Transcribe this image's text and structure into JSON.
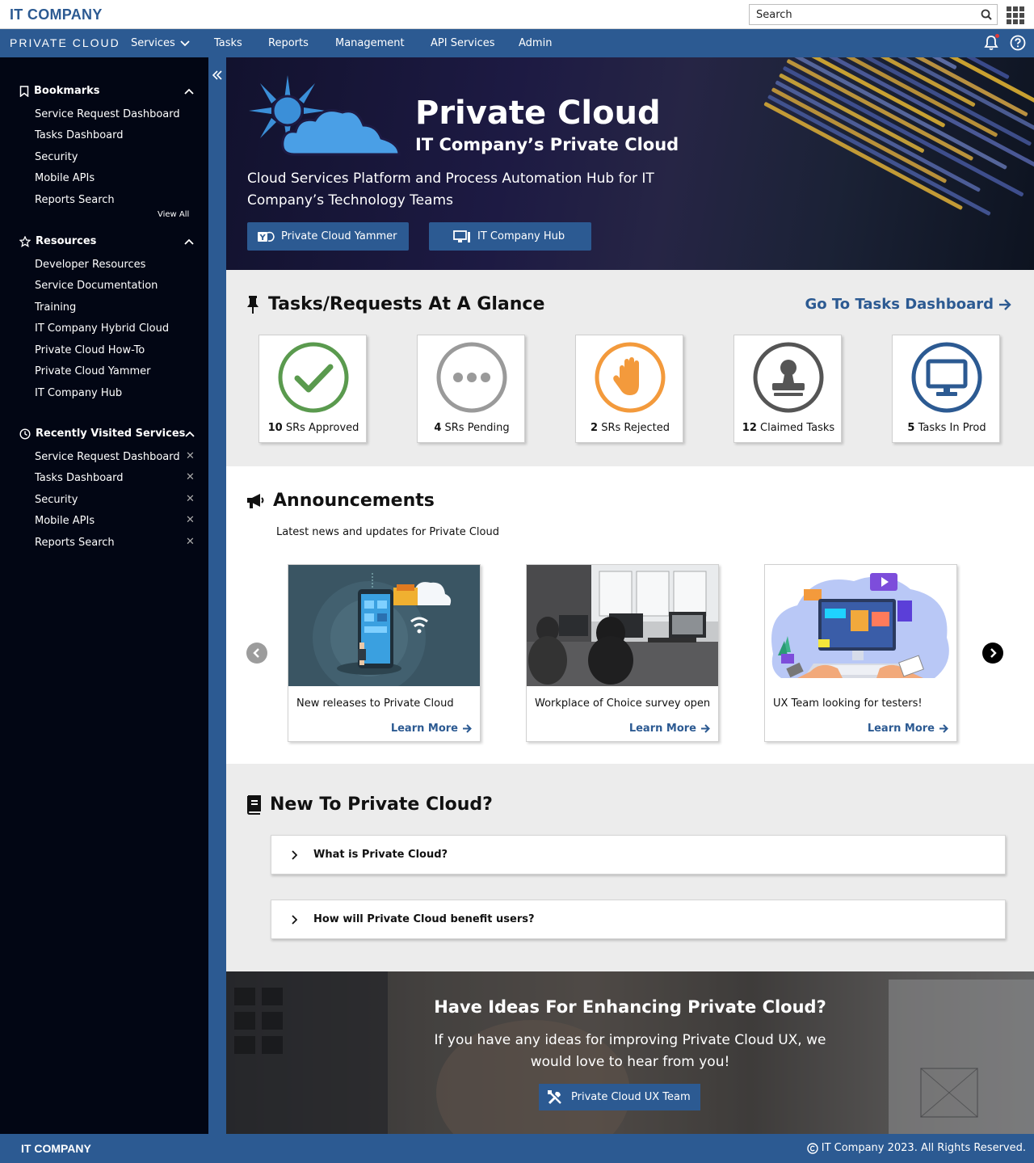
{
  "topbar": {
    "logo": "IT COMPANY",
    "search_placeholder": "Search"
  },
  "navbar": {
    "brand": "PRIVATE CLOUD",
    "items": [
      {
        "label": "Services"
      },
      {
        "label": "Tasks"
      },
      {
        "label": "Reports"
      },
      {
        "label": "Management"
      },
      {
        "label": "API Services"
      },
      {
        "label": "Admin"
      }
    ]
  },
  "sidebar": {
    "bookmarks": {
      "title": "Bookmarks",
      "items": [
        "Service Request Dashboard",
        "Tasks Dashboard",
        "Security",
        "Mobile APIs",
        "Reports Search"
      ],
      "view_all": "View All"
    },
    "resources": {
      "title": "Resources",
      "items": [
        "Developer Resources",
        "Service Documentation",
        "Training",
        "IT Company Hybrid Cloud",
        "Private Cloud How-To",
        "Private Cloud Yammer",
        "IT Company Hub"
      ]
    },
    "recent": {
      "title": "Recently Visited Services",
      "items": [
        "Service Request Dashboard",
        "Tasks Dashboard",
        "Security",
        "Mobile APIs",
        "Reports Search"
      ]
    }
  },
  "hero": {
    "title": "Private Cloud",
    "subtitle": "IT Company’s Private Cloud",
    "description": "Cloud Services Platform and Process Automation Hub for IT Company’s Technology Teams",
    "buttons": [
      "Private Cloud Yammer",
      "IT Company Hub"
    ]
  },
  "tasks": {
    "title": "Tasks/Requests At A Glance",
    "link": "Go To Tasks Dashboard",
    "cards": [
      {
        "count": "10",
        "label": "SRs Approved",
        "color": "#5a9a4e"
      },
      {
        "count": "4",
        "label": "SRs Pending",
        "color": "#9a9a9a"
      },
      {
        "count": "2",
        "label": "SRs Rejected",
        "color": "#f39a3c"
      },
      {
        "count": "12",
        "label": "Claimed Tasks",
        "color": "#555555"
      },
      {
        "count": "5",
        "label": "Tasks In Prod",
        "color": "#2c5a92"
      }
    ]
  },
  "announcements": {
    "title": "Announcements",
    "subtitle": "Latest news and updates for Private Cloud",
    "cards": [
      {
        "text": "New releases to Private Cloud",
        "more": "Learn More"
      },
      {
        "text": "Workplace of Choice survey open",
        "more": "Learn More"
      },
      {
        "text": "UX Team looking for testers!",
        "more": "Learn More"
      }
    ]
  },
  "newto": {
    "title": "New To Private Cloud?",
    "faqs": [
      "What is Private Cloud?",
      "How will Private Cloud benefit users?"
    ]
  },
  "ideas": {
    "title": "Have Ideas For Enhancing Private Cloud?",
    "description": "If you have any ideas for improving Private Cloud UX, we would love to hear from you!",
    "button": "Private Cloud UX Team"
  },
  "footer": {
    "logo": "IT COMPANY",
    "copyright": "IT Company 2023. All Rights Reserved."
  },
  "colors": {
    "brand": "#2c5a92",
    "sidebar": "#020614",
    "section_bg": "#ececec"
  }
}
